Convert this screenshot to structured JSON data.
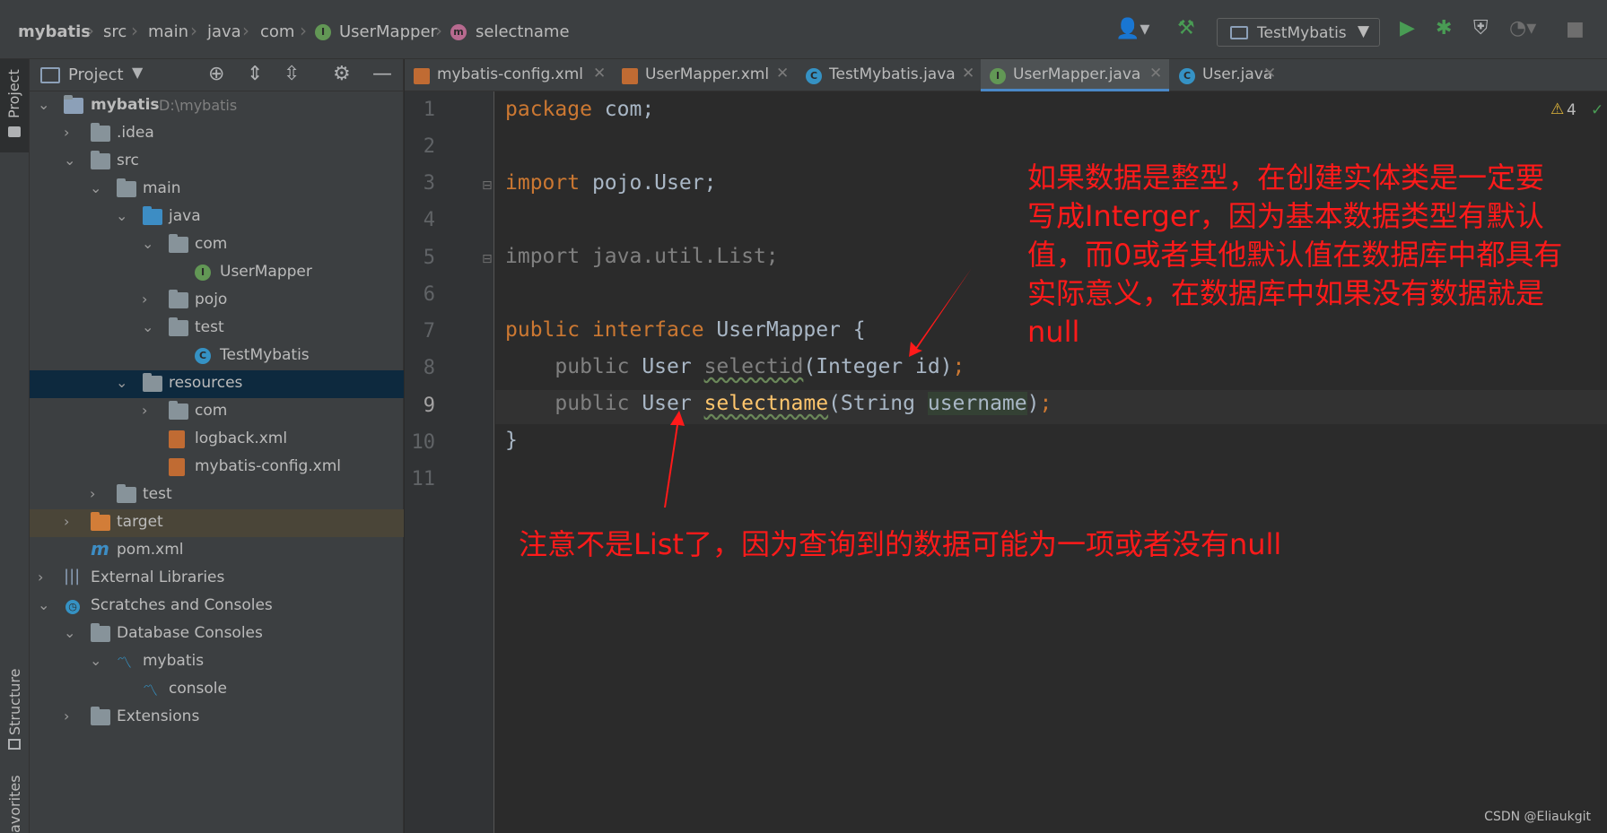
{
  "nav": {
    "crumbs": [
      "mybatis",
      "src",
      "main",
      "java",
      "com",
      "UserMapper",
      "selectname"
    ],
    "run_config": "TestMybatis"
  },
  "tool_strip": {
    "project": "Project",
    "structure": "Structure",
    "favorites": "avorites"
  },
  "project": {
    "header": "Project",
    "tree": [
      {
        "label": "mybatis",
        "path": "D:\\mybatis"
      },
      {
        "label": ".idea"
      },
      {
        "label": "src"
      },
      {
        "label": "main"
      },
      {
        "label": "java"
      },
      {
        "label": "com"
      },
      {
        "label": "UserMapper"
      },
      {
        "label": "pojo"
      },
      {
        "label": "test"
      },
      {
        "label": "TestMybatis"
      },
      {
        "label": "resources"
      },
      {
        "label": "com"
      },
      {
        "label": "logback.xml"
      },
      {
        "label": "mybatis-config.xml"
      },
      {
        "label": "test"
      },
      {
        "label": "target"
      },
      {
        "label": "pom.xml"
      },
      {
        "label": "External Libraries"
      },
      {
        "label": "Scratches and Consoles"
      },
      {
        "label": "Database Consoles"
      },
      {
        "label": "mybatis"
      },
      {
        "label": "console"
      },
      {
        "label": "Extensions"
      }
    ]
  },
  "tabs": [
    {
      "label": "mybatis-config.xml"
    },
    {
      "label": "UserMapper.xml"
    },
    {
      "label": "TestMybatis.java"
    },
    {
      "label": "UserMapper.java"
    },
    {
      "label": "User.java"
    }
  ],
  "editor": {
    "line_numbers": [
      "1",
      "2",
      "3",
      "4",
      "5",
      "6",
      "7",
      "8",
      "9",
      "10",
      "11"
    ],
    "warnings": "4",
    "code": {
      "l1_kw": "package",
      "l1_rest": " com;",
      "l3_kw": "import",
      "l3_rest": " pojo.User;",
      "l5": "import java.util.List;",
      "l7_kw1": "public",
      "l7_kw2": " interface",
      "l7_rest": " UserMapper {",
      "l8_a": "    public",
      "l8_b": " User ",
      "l8_c": "selectid",
      "l8_d": "(Integer id)",
      "l8_e": ";",
      "l9_a": "    public",
      "l9_b": " User ",
      "l9_c": "selectname",
      "l9_d": "(String ",
      "l9_e": "username",
      "l9_f": ")",
      "l9_g": ";",
      "l10": "}"
    }
  },
  "annotations": {
    "top": [
      "如果数据是整型，在创建实体类是一定要",
      "写成Interger，因为基本数据类型有默认",
      "值，而0或者其他默认值在数据库中都具有",
      "实际意义，在数据库中如果没有数据就是",
      "null"
    ],
    "bottom": "注意不是List了，因为查询到的数据可能为一项或者没有null"
  },
  "watermark": "CSDN @Eliaukgit"
}
